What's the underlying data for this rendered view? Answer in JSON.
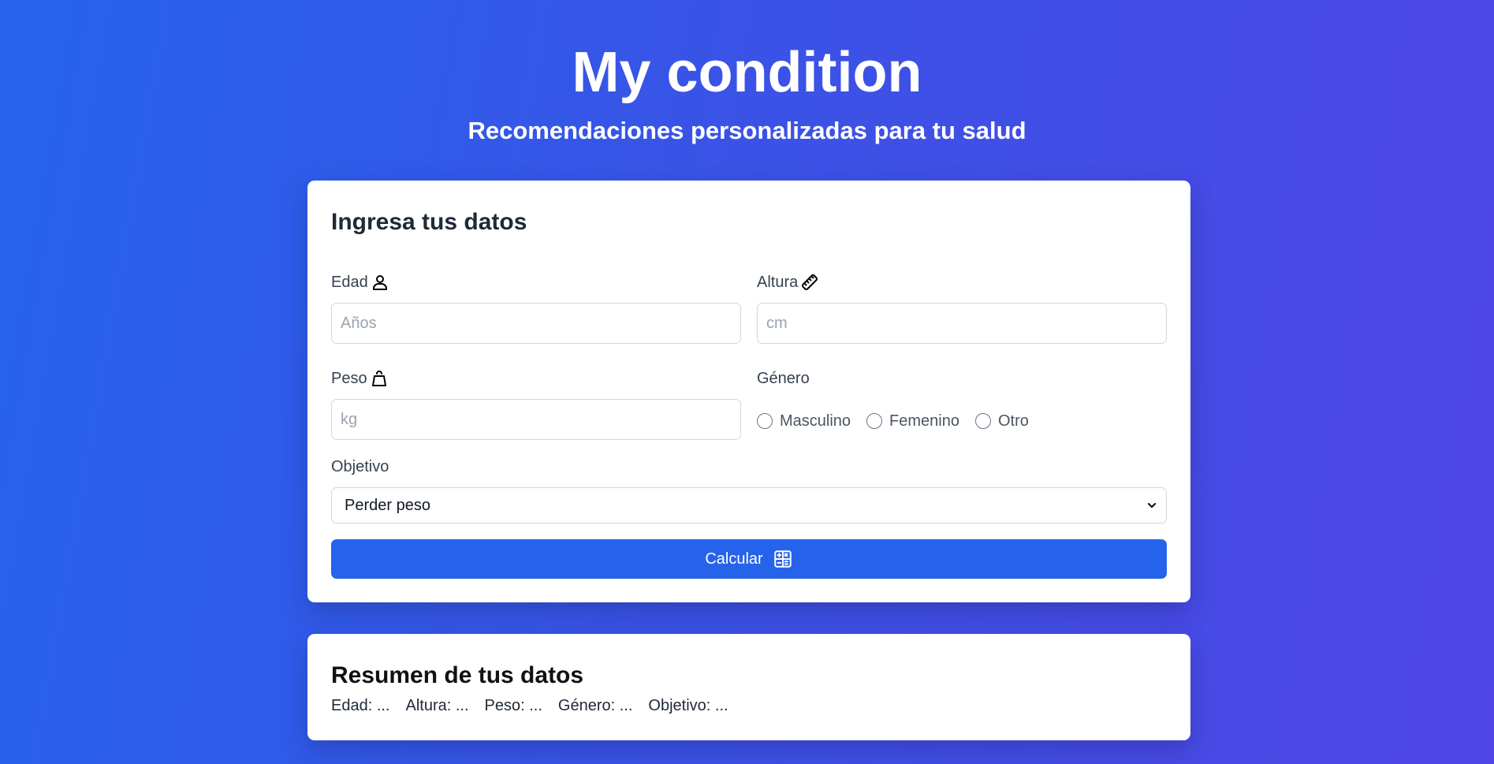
{
  "header": {
    "title": "My condition",
    "subtitle": "Recomendaciones personalizadas para tu salud"
  },
  "form": {
    "title": "Ingresa tus datos",
    "age": {
      "label": "Edad",
      "placeholder": "Años",
      "value": "",
      "icon": "person-icon"
    },
    "height": {
      "label": "Altura",
      "placeholder": "cm",
      "value": "",
      "icon": "ruler-icon"
    },
    "weight": {
      "label": "Peso",
      "placeholder": "kg",
      "value": "",
      "icon": "weight-icon"
    },
    "gender": {
      "label": "Género",
      "options": [
        "Masculino",
        "Femenino",
        "Otro"
      ],
      "selected": null
    },
    "goal": {
      "label": "Objetivo",
      "selected": "Perder peso",
      "icon": "chevron-down-icon"
    },
    "submit_label": "Calcular",
    "submit_icon": "calculator-icon"
  },
  "summary": {
    "title": "Resumen de tus datos",
    "items": [
      "Edad: ...",
      "Altura: ...",
      "Peso: ...",
      "Género: ...",
      "Objetivo: ..."
    ]
  },
  "colors": {
    "background_start": "#2563eb",
    "background_end": "#4f46e5",
    "primary_button": "#2563eb",
    "card": "#ffffff"
  }
}
